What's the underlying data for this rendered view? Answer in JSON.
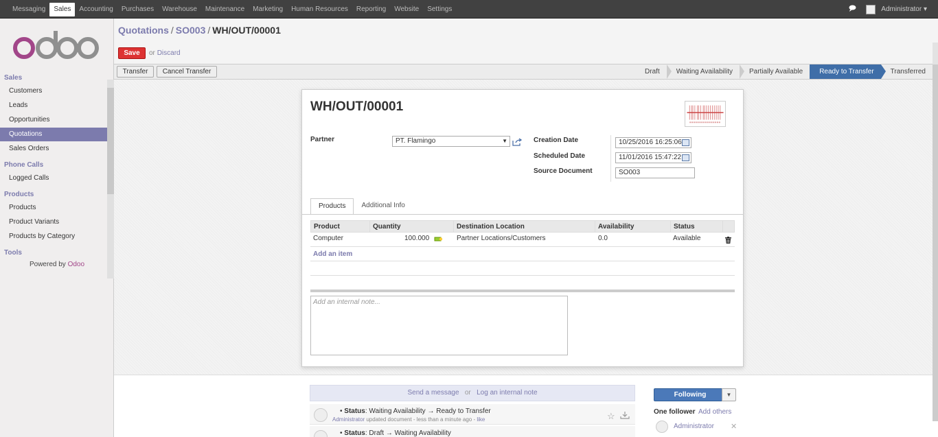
{
  "topbar": {
    "menu": [
      "Messaging",
      "Sales",
      "Accounting",
      "Purchases",
      "Warehouse",
      "Maintenance",
      "Marketing",
      "Human Resources",
      "Reporting",
      "Website",
      "Settings"
    ],
    "active_index": 1,
    "chat_icon": "chat-icon",
    "user": "Administrator",
    "caret": "▾"
  },
  "sidebar": {
    "logo_text": "odoo",
    "sections": [
      {
        "title": "Sales",
        "items": [
          "Customers",
          "Leads",
          "Opportunities",
          "Quotations",
          "Sales Orders"
        ]
      },
      {
        "title": "Phone Calls",
        "items": [
          "Logged Calls"
        ]
      },
      {
        "title": "Products",
        "items": [
          "Products",
          "Product Variants",
          "Products by Category"
        ]
      },
      {
        "title": "Tools",
        "items": []
      }
    ],
    "active_item": "Quotations",
    "powered_prefix": "Powered by",
    "powered_brand": "Odoo"
  },
  "breadcrumb": {
    "items": [
      "Quotations",
      "SO003"
    ],
    "current": "WH/OUT/00001",
    "sep": "/"
  },
  "actions": {
    "save": "Save",
    "or": "or",
    "discard": "Discard"
  },
  "toolbar": {
    "transfer": "Transfer",
    "cancel_transfer": "Cancel Transfer"
  },
  "stages": {
    "items": [
      "Draft",
      "Waiting Availability",
      "Partially Available",
      "Ready to Transfer",
      "Transferred"
    ],
    "current": "Ready to Transfer",
    "current_color": "#3f6ea8"
  },
  "form": {
    "title": "WH/OUT/00001",
    "partner_label": "Partner",
    "partner_value": "PT. Flamingo",
    "creation_date_label": "Creation Date",
    "creation_date_value": "10/25/2016 16:25:06",
    "scheduled_date_label": "Scheduled Date",
    "scheduled_date_value": "11/01/2016 15:47:22",
    "source_document_label": "Source Document",
    "source_document_value": "SO003"
  },
  "tabs": [
    "Products",
    "Additional Info"
  ],
  "table": {
    "columns": [
      "Product",
      "Quantity",
      "Destination Location",
      "Availability",
      "Status"
    ],
    "rows": [
      {
        "product": "Computer",
        "quantity": "100.000",
        "destination": "Partner Locations/Customers",
        "availability": "0.0",
        "status": "Available"
      }
    ],
    "add_item": "Add an item"
  },
  "note_placeholder": "Add an internal note...",
  "chatter": {
    "send_message": "Send a message",
    "or": "or",
    "log_note": "Log an internal note",
    "messages": [
      {
        "field": "Status",
        "text": "Waiting Availability → Ready to Transfer",
        "author": "Administrator",
        "meta": "updated document - less than a minute ago -",
        "like": "like"
      },
      {
        "field": "Status",
        "text": "Draft → Waiting Availability"
      }
    ],
    "following": "Following",
    "followers_label": "One follower",
    "add_others": "Add others",
    "follower_name": "Administrator"
  }
}
